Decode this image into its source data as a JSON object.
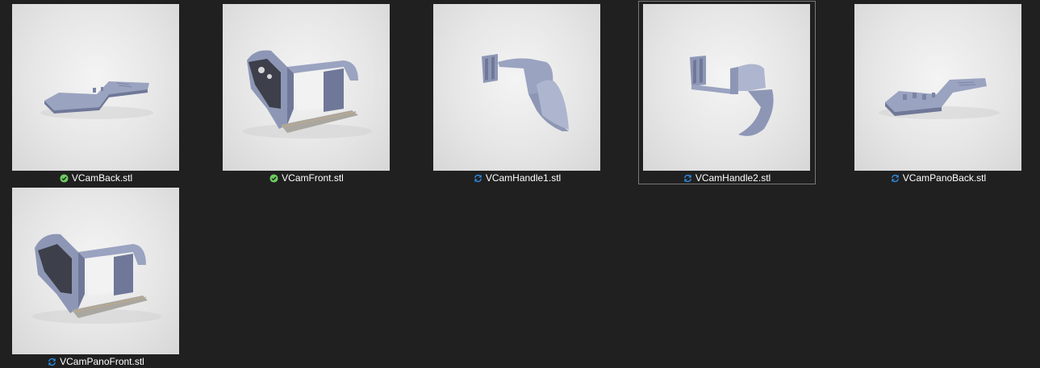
{
  "files": [
    {
      "name": "VCamBack.stl",
      "status": "synced",
      "status_icon": "check-circle-icon",
      "selected": false,
      "model": "back-plate-icon"
    },
    {
      "name": "VCamFront.stl",
      "status": "synced",
      "status_icon": "check-circle-icon",
      "selected": false,
      "model": "front-housing-icon"
    },
    {
      "name": "VCamHandle1.stl",
      "status": "syncing",
      "status_icon": "sync-arrows-icon",
      "selected": false,
      "model": "handle-icon"
    },
    {
      "name": "VCamHandle2.stl",
      "status": "syncing",
      "status_icon": "sync-arrows-icon",
      "selected": true,
      "model": "handle-icon"
    },
    {
      "name": "VCamPanoBack.stl",
      "status": "syncing",
      "status_icon": "sync-arrows-icon",
      "selected": false,
      "model": "pano-back-plate-icon"
    },
    {
      "name": "VCamPanoFront.stl",
      "status": "syncing",
      "status_icon": "sync-arrows-icon",
      "selected": false,
      "model": "pano-front-housing-icon"
    }
  ],
  "colors": {
    "background": "#202020",
    "synced": "#6ccb5f",
    "syncing": "#2f8fe8",
    "model": "#8d97b5"
  }
}
